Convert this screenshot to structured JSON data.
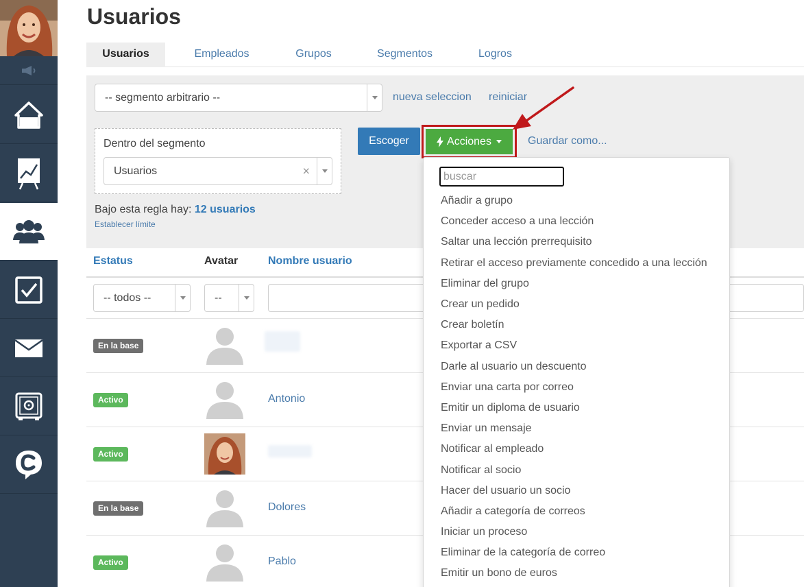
{
  "page_title": "Usuarios",
  "tabs": [
    {
      "label": "Usuarios"
    },
    {
      "label": "Empleados"
    },
    {
      "label": "Grupos"
    },
    {
      "label": "Segmentos"
    },
    {
      "label": "Logros"
    }
  ],
  "filters": {
    "segment_select": "-- segmento arbitrario --",
    "new_selection": "nueva seleccion",
    "reset": "reiniciar",
    "within_label": "Dentro del segmento",
    "within_value": "Usuarios",
    "choose_button": "Escoger",
    "actions_button": "Acciones",
    "save_as": "Guardar como...",
    "rule_prefix": "Bajo esta regla hay: ",
    "rule_count": "12 usuarios",
    "set_limit": "Establecer límite"
  },
  "table": {
    "headers": {
      "status": "Estatus",
      "avatar": "Avatar",
      "username": "Nombre usuario"
    },
    "status_filter": "-- todos --",
    "avatar_filter": "--",
    "rows": [
      {
        "status": "En la base",
        "name": ""
      },
      {
        "status": "Activo",
        "name": "Antonio"
      },
      {
        "status": "Activo",
        "name": ""
      },
      {
        "status": "En la base",
        "name": "Dolores"
      },
      {
        "status": "Activo",
        "name": "Pablo"
      }
    ]
  },
  "dropdown": {
    "search_placeholder": "buscar",
    "items": [
      "Añadir a grupo",
      "Conceder acceso a una lección",
      "Saltar una lección prerrequisito",
      "Retirar el acceso previamente concedido a una lección",
      "Eliminar del grupo",
      "Crear un pedido",
      "Crear boletín",
      "Exportar a CSV",
      "Darle al usuario un descuento",
      "Enviar una carta por correo",
      "Emitir un diploma de usuario",
      "Enviar un mensaje",
      "Notificar al empleado",
      "Notificar al socio",
      "Hacer del usuario un socio",
      "Añadir a categoría de correos",
      "Iniciar un proceso",
      "Eliminar de la categoría de correo",
      "Emitir un bono de euros"
    ]
  },
  "sidebar": {
    "items": [
      {
        "icon": "home-icon"
      },
      {
        "icon": "chart-board-icon"
      },
      {
        "icon": "users-icon"
      },
      {
        "icon": "checkbox-icon"
      },
      {
        "icon": "envelope-icon"
      },
      {
        "icon": "safe-icon"
      },
      {
        "icon": "chat-c-icon"
      }
    ]
  },
  "colors": {
    "sidebar": "#2e4053",
    "primary": "#337ab7",
    "success": "#4caa40",
    "highlight": "#c0191b"
  }
}
